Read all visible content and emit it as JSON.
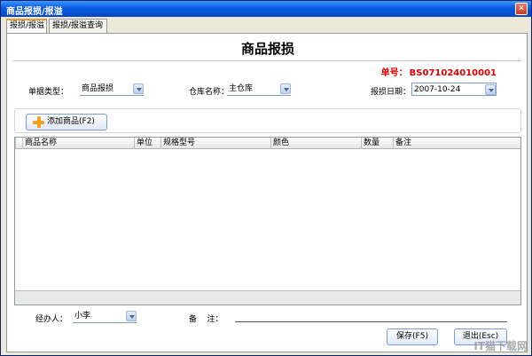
{
  "window": {
    "title": "商品报损/报溢",
    "close_glyph": "✕"
  },
  "tabs": [
    {
      "label": "报损/报溢",
      "active": true
    },
    {
      "label": "报损/报溢查询",
      "active": false
    }
  ],
  "form": {
    "title": "商品报损",
    "order_no_label": "单号：",
    "order_no_value": "BS071024010001",
    "doc_type_label": "单据类型：",
    "doc_type_value": "商品报损",
    "warehouse_label": "仓库名称：",
    "warehouse_value": "主仓库",
    "date_label": "报损日期：",
    "date_value": "2007-10-24"
  },
  "toolbar": {
    "add_label": "添加商品(F2)"
  },
  "grid": {
    "columns": [
      "商品名称",
      "单位",
      "规格型号",
      "颜色",
      "数量",
      "备注"
    ],
    "rows": []
  },
  "footer": {
    "handler_label": "经办人：",
    "handler_value": "小李",
    "remark_label": "备    注：",
    "remark_value": "",
    "save_label": "保存(F5)",
    "exit_label": "退出(Esc)"
  },
  "watermark": "IT猫下载网",
  "colors": {
    "order_no": "#e00000",
    "title_bar": "#0a5be0",
    "tab_accent": "#e79d2a"
  }
}
